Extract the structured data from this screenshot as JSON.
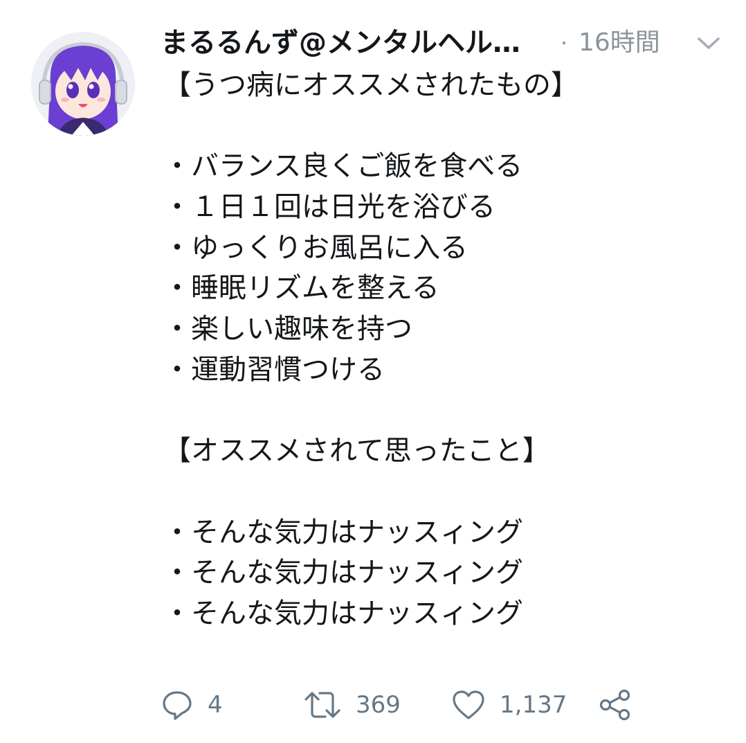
{
  "tweet": {
    "display_name": "まるるんず@メンタルヘル…",
    "separator": "·",
    "timestamp": "16時間",
    "lines": [
      "【うつ病にオススメされたもの】",
      "",
      "・バランス良くご飯を食べる",
      "・１日１回は日光を浴びる",
      "・ゆっくりお風呂に入る",
      "・睡眠リズムを整える",
      "・楽しい趣味を持つ",
      "・運動習慣つける",
      "",
      "【オススメされて思ったこと】",
      "",
      "・そんな気力はナッスィング",
      "・そんな気力はナッスィング",
      "・そんな気力はナッスィング"
    ]
  },
  "actions": {
    "reply_count": "4",
    "retweet_count": "369",
    "like_count": "1,137"
  },
  "icons": {
    "avatar": "avatar-anime-girl",
    "caret": "chevron-down-icon",
    "reply": "reply-icon",
    "retweet": "retweet-icon",
    "like": "heart-icon",
    "share": "share-icon"
  },
  "colors": {
    "text": "#14171a",
    "secondary": "#8a949c",
    "icon": "#657786",
    "avatar_hair": "#6a3fd1"
  }
}
